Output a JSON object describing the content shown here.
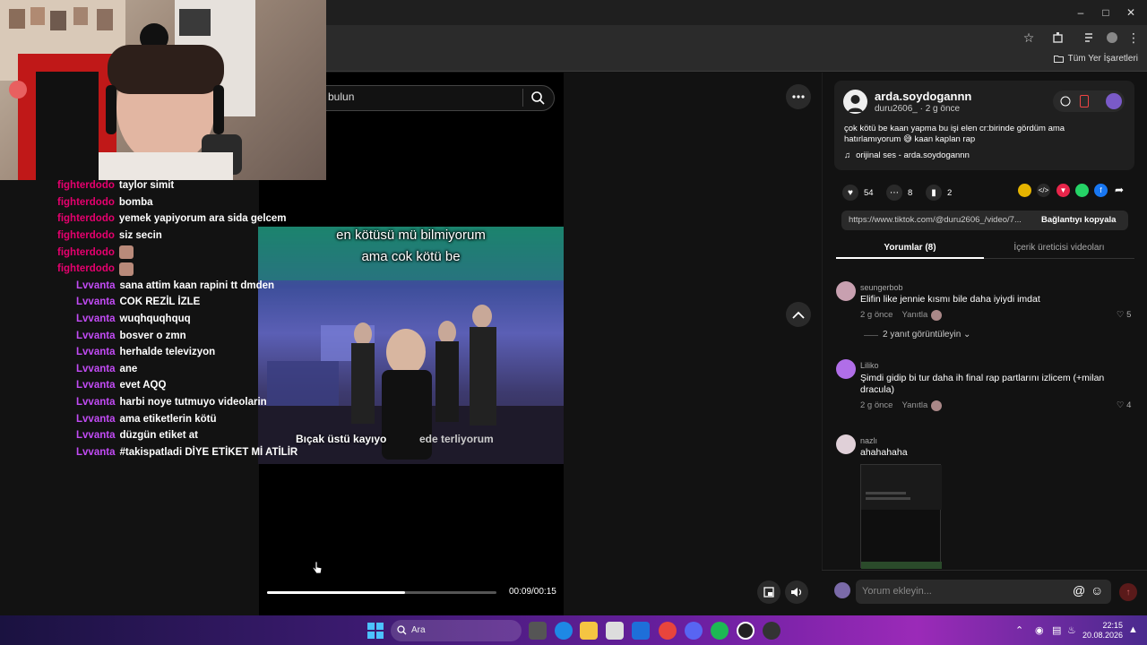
{
  "browser": {
    "bookmarks_label": "Tüm Yer İşaretleri"
  },
  "stream_chat": [
    {
      "user": "fighterdodo",
      "message": "taylor simit",
      "type": "fd"
    },
    {
      "user": "fighterdodo",
      "message": "bomba",
      "type": "fd"
    },
    {
      "user": "fighterdodo",
      "message": "yemek yapiyorum ara sida gelcem",
      "type": "fd"
    },
    {
      "user": "fighterdodo",
      "message": "siz secin",
      "type": "fd"
    },
    {
      "user": "fighterdodo",
      "message": "",
      "type": "fd",
      "emote": true
    },
    {
      "user": "fighterdodo",
      "message": "",
      "type": "fd",
      "emote": true
    },
    {
      "user": "Lvvanta",
      "message": "sana attim kaan rapini tt dmden",
      "type": "lv"
    },
    {
      "user": "Lvvanta",
      "message": "COK REZİL İZLE",
      "type": "lv"
    },
    {
      "user": "Lvvanta",
      "message": "wuqhquqhquq",
      "type": "lv"
    },
    {
      "user": "Lvvanta",
      "message": "bosver o zmn",
      "type": "lv"
    },
    {
      "user": "Lvvanta",
      "message": "herhalde televizyon",
      "type": "lv"
    },
    {
      "user": "Lvvanta",
      "message": "ane",
      "type": "lv"
    },
    {
      "user": "Lvvanta",
      "message": "evet AQQ",
      "type": "lv"
    },
    {
      "user": "Lvvanta",
      "message": "harbi noye tutmuyo videolarin",
      "type": "lv"
    },
    {
      "user": "Lvvanta",
      "message": "ama etiketlerin kötü",
      "type": "lv"
    },
    {
      "user": "Lvvanta",
      "message": "düzgün etiket at",
      "type": "lv"
    },
    {
      "user": "Lvvanta",
      "message": "#takispatladi DİYE ETİKET Mİ ATİLİR",
      "type": "lv"
    }
  ],
  "search": {
    "text": "bulun"
  },
  "video": {
    "caption_line1": "en kötüsü mü bilmiyorum",
    "caption_line2": "ama cok kötü be",
    "subtitle_left": "Bıçak üstü kayıyo",
    "subtitle_right": "ede terliyorum",
    "time": "00:09/00:15",
    "progress": 0.6
  },
  "post": {
    "author": "arda.soydogannn",
    "sub_user": "duru2606_",
    "sub_time": "2 g önce",
    "description": "çok kötü be kaan yapma bu işi elen cr:birinde gördüm ama hatırlamıyorum 😅 kaan kaplan rap",
    "music": "orijinal ses - arda.soydogannn",
    "likes": "54",
    "comments": "8",
    "saves": "2",
    "url": "https://www.tiktok.com/@duru2606_/video/7...",
    "copy_label": "Bağlantıyı kopyala"
  },
  "tabs": {
    "comments": "Yorumlar (8)",
    "creator": "İçerik üreticisi videoları"
  },
  "comments": [
    {
      "user": "seungerbob",
      "text": "Elifin like jennie kısmı bile daha iyiydi imdat",
      "time": "2 g önce",
      "reply": "Yanıtla",
      "likes": "5"
    },
    {
      "user": "Liliko",
      "text": "Şimdi gidip bi tur daha ih final rap partlarını izlicem (+milan dracula)",
      "time": "2 g önce",
      "reply": "Yanıtla",
      "likes": "4"
    },
    {
      "user": "nazlı",
      "text": "ahahahaha"
    }
  ],
  "replies_label": "2 yanıt görüntüleyin",
  "comment_placeholder": "Yorum ekleyin...",
  "taskbar": {
    "search": "Ara",
    "time": "22:15",
    "date": "20.08.2026"
  },
  "colors": {
    "fighterdodo": "#e6006e",
    "lvvanta": "#c24bf5"
  }
}
